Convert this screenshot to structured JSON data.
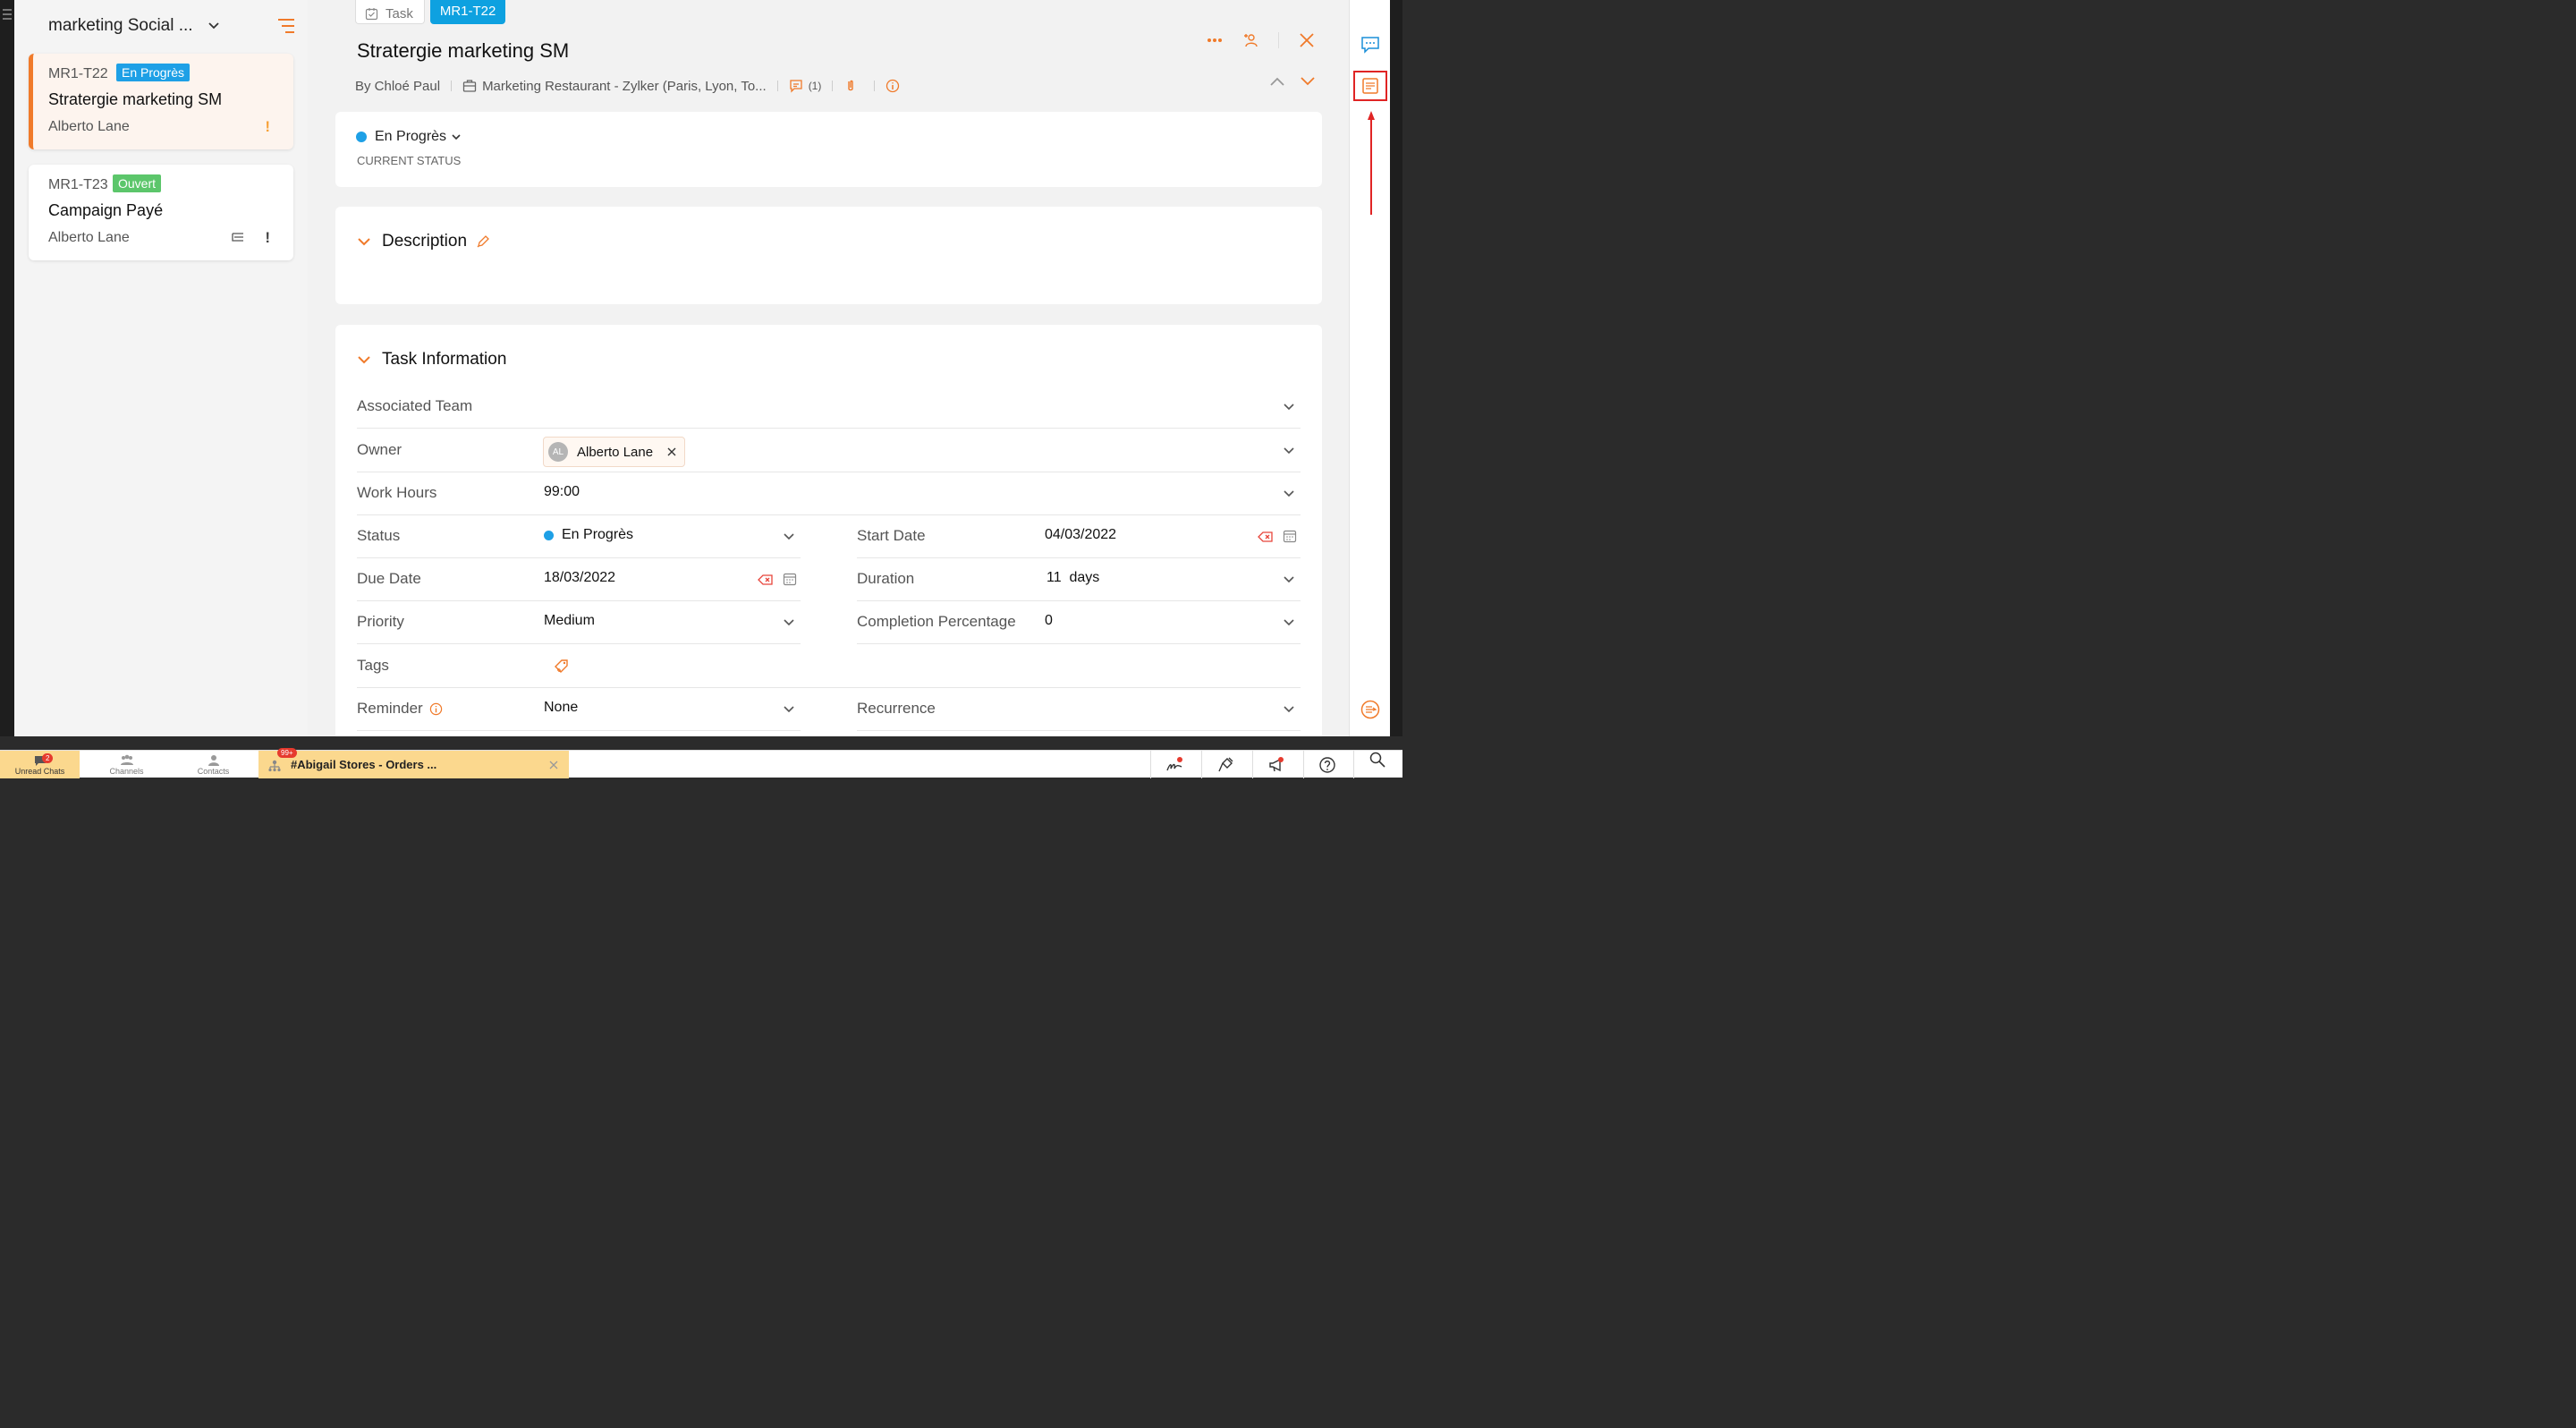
{
  "sidebar": {
    "title": "marketing Social ...",
    "cards": [
      {
        "id": "MR1-T22",
        "status": "En Progrès",
        "status_color": "#1ea0e6",
        "title": "Stratergie marketing SM",
        "owner": "Alberto Lane",
        "priority_mark": "!",
        "priority_color": "#f7a23a"
      },
      {
        "id": "MR1-T23",
        "status": "Ouvert",
        "status_color": "#5cc66b",
        "title": "Campaign Payé",
        "owner": "Alberto Lane",
        "priority_mark": "!",
        "priority_color": "#444"
      }
    ]
  },
  "header": {
    "crumb_task": "Task",
    "crumb_id": "MR1-T22",
    "title": "Stratergie marketing SM",
    "by": "By Chloé Paul",
    "project": "Marketing Restaurant - Zylker (Paris, Lyon, To...",
    "comment_count": "(1)"
  },
  "status_panel": {
    "status": "En Progrès",
    "caption": "CURRENT STATUS"
  },
  "description": {
    "heading": "Description"
  },
  "task_info": {
    "heading": "Task Information",
    "associated_team_label": "Associated Team",
    "owner_label": "Owner",
    "owner_initials": "AL",
    "owner_name": "Alberto Lane",
    "work_hours_label": "Work Hours",
    "work_hours": "99:00",
    "status_label": "Status",
    "status": "En Progrès",
    "start_date_label": "Start Date",
    "start_date": "04/03/2022",
    "due_date_label": "Due Date",
    "due_date": "18/03/2022",
    "duration_label": "Duration",
    "duration": "11  days",
    "priority_label": "Priority",
    "priority": "Medium",
    "completion_label": "Completion Percentage",
    "completion": "0",
    "tags_label": "Tags",
    "reminder_label": "Reminder",
    "reminder": "None",
    "recurrence_label": "Recurrence"
  },
  "bottom_bar": {
    "unread_label": "Unread Chats",
    "unread_count": "2",
    "channels_label": "Channels",
    "contacts_label": "Contacts",
    "channel_badge": "99+",
    "channel_name": "#Abigail Stores - Orders ..."
  },
  "colors": {
    "accent": "#f07a2a",
    "blue": "#0ea1e0",
    "highlight": "#e02424"
  }
}
